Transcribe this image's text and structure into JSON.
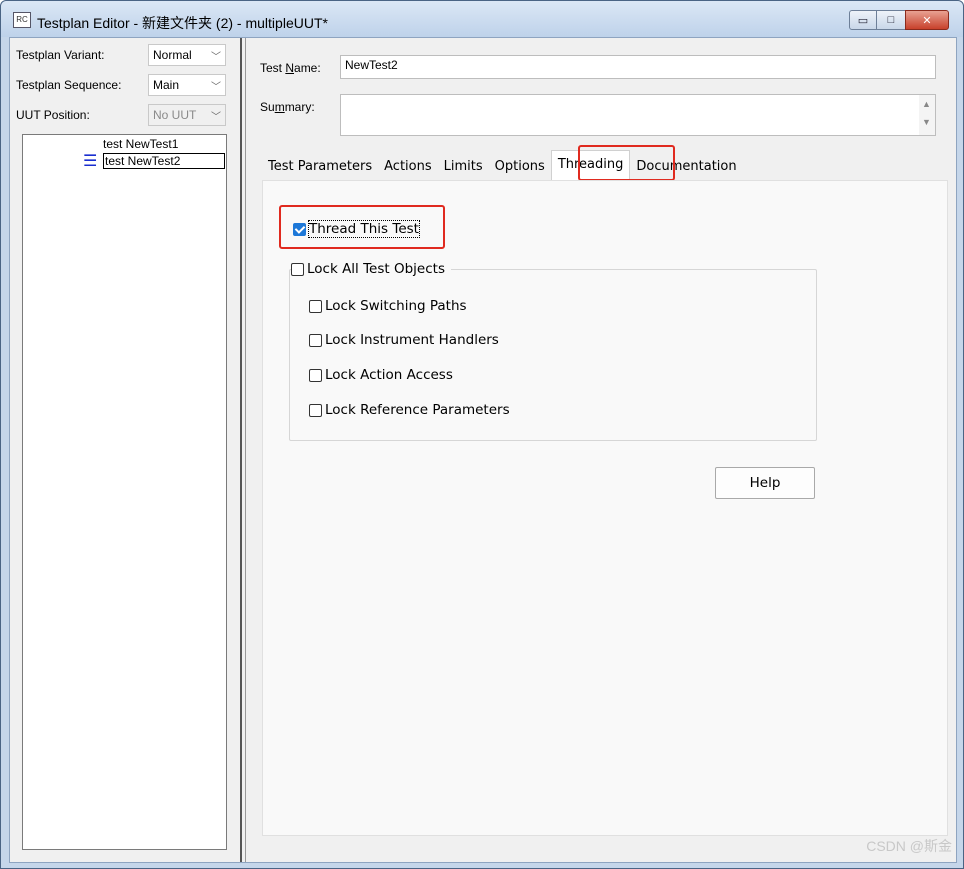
{
  "window": {
    "app_icon_text": "RC",
    "title": "Testplan Editor - 新建文件夹 (2) - multipleUUT*",
    "buttons": {
      "minimize": "▭",
      "maximize": "□",
      "close": "✕"
    }
  },
  "left_pane": {
    "variant": {
      "label": "Testplan Variant:",
      "value": "Normal"
    },
    "sequence": {
      "label": "Testplan Sequence:",
      "value": "Main"
    },
    "uut_position": {
      "label": "UUT Position:",
      "value": "No UUT"
    },
    "tree_items": [
      "test NewTest1",
      "test NewTest2"
    ],
    "selected_index": 1
  },
  "right_pane": {
    "test_name": {
      "label": "Test Name:",
      "value": "NewTest2"
    },
    "summary": {
      "label": "Summary:",
      "value": ""
    },
    "tabs": [
      "Test Parameters",
      "Actions",
      "Limits",
      "Options",
      "Threading",
      "Documentation"
    ],
    "active_tab": "Threading",
    "threading": {
      "thread_this_test": {
        "label": "Thread This Test",
        "checked": true
      },
      "lock_all": {
        "label": "Lock All Test Objects",
        "checked": false
      },
      "locks": [
        {
          "label": "Lock Switching Paths",
          "checked": false
        },
        {
          "label": "Lock Instrument Handlers",
          "checked": false
        },
        {
          "label": "Lock Action Access",
          "checked": false
        },
        {
          "label": "Lock Reference Parameters",
          "checked": false
        }
      ],
      "help_button": "Help"
    }
  },
  "watermark": "CSDN @斯金",
  "colors": {
    "highlight_box": "#e02a1f",
    "checkbox_checked": "#1d78d8",
    "tree_marker": "#1a2ed0"
  }
}
